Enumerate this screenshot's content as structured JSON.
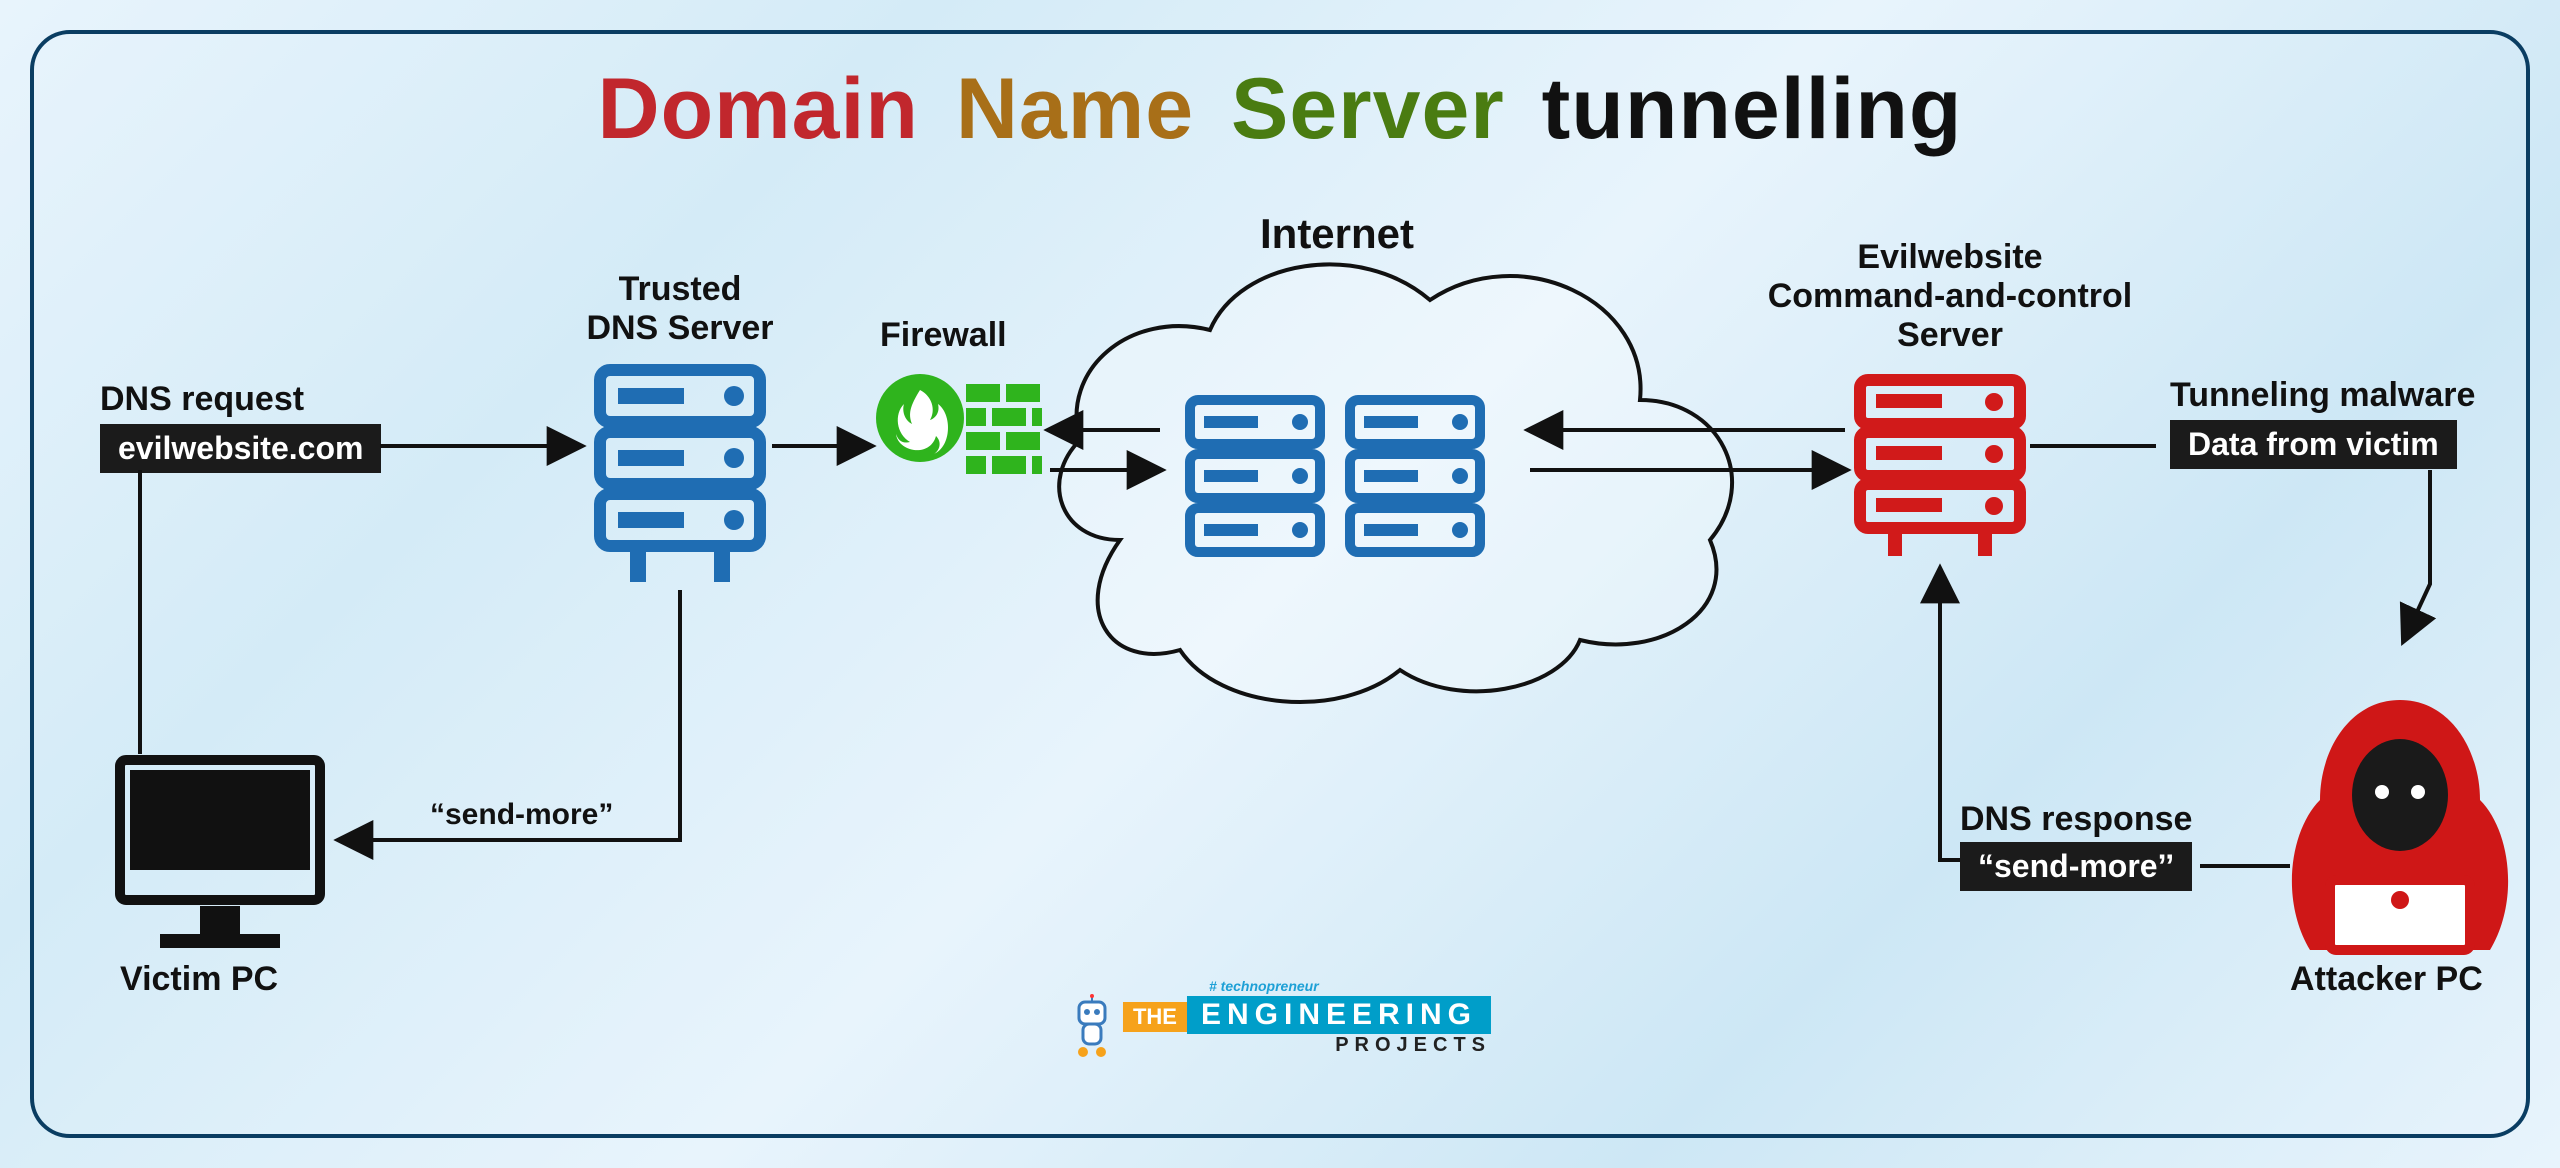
{
  "title": {
    "w1": "Domain",
    "w2": "Name",
    "w3": "Server",
    "w4": "tunnelling"
  },
  "nodes": {
    "victim_pc": "Victim PC",
    "trusted_dns": "Trusted\nDNS Server",
    "firewall": "Firewall",
    "internet": "Internet",
    "evil_server": "Evilwebsite\nCommand-and-control\nServer",
    "attacker_pc": "Attacker PC"
  },
  "labels": {
    "dns_request": "DNS request",
    "dns_request_pill": "evilwebsite.com",
    "send_more_left": "“send-more”",
    "tunneling_malware": "Tunneling malware",
    "tunneling_pill": "Data from victim",
    "dns_response": "DNS response",
    "dns_response_pill": "“send-more’’"
  },
  "branding": {
    "hash": "# technopreneur",
    "the": "THE",
    "eng": "ENGINEERING",
    "projects": "PROJECTS"
  },
  "colors": {
    "server_blue": "#1f6db3",
    "server_red": "#d11a1a",
    "firewall_green": "#2fb41d",
    "stroke": "#111111"
  }
}
